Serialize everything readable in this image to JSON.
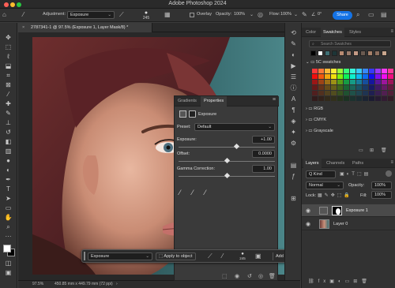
{
  "app_title": "Adobe Photoshop 2024",
  "options_bar": {
    "adjustment_label": "Adjustment:",
    "adjustment_value": "Exposure",
    "brush_size": "245",
    "overlay_label": "Overlay",
    "opacity_label": "Opacity:",
    "opacity_value": "100%",
    "flow_label": "Flow:",
    "flow_value": "100%",
    "angle_value": "0°",
    "share_label": "Share"
  },
  "document": {
    "tab_label": "2787341-1 @ 97.5% (Exposure 1, Layer Mask/8) *",
    "zoom": "97.5%",
    "dimensions": "450.85 mm x 449.79 mm (72 ppi)"
  },
  "properties": {
    "tabs": [
      "Gradients",
      "Properties"
    ],
    "active_tab": "Properties",
    "section_title": "Exposure",
    "preset_label": "Preset:",
    "preset_value": "Default",
    "exposure_label": "Exposure:",
    "exposure_value": "+1.00",
    "exposure_pos": 0.6,
    "offset_label": "Offset:",
    "offset_value": "0.0000",
    "offset_pos": 0.5,
    "gamma_label": "Gamma Correction:",
    "gamma_value": "1.00",
    "gamma_pos": 0.5
  },
  "taskbar": {
    "adjustment_value": "Exposure",
    "apply_label": "Apply to object",
    "brush_size": "245",
    "add_label": "Add new adjustment",
    "more_label": "···"
  },
  "swatches_panel": {
    "tabs": [
      "Color",
      "Swatches",
      "Styles"
    ],
    "active_tab": "Swatches",
    "search_placeholder": "Search Swatches",
    "folders": [
      "5C swatches",
      "RGB",
      "CMYK",
      "Grayscale"
    ]
  },
  "layers_panel": {
    "tabs": [
      "Layers",
      "Channels",
      "Paths"
    ],
    "active_tab": "Layers",
    "kind_label": "Q Kind",
    "blend_mode": "Normal",
    "opacity_label": "Opacity:",
    "opacity_value": "100%",
    "lock_label": "Lock:",
    "fill_label": "Fill:",
    "fill_value": "100%",
    "layers": [
      {
        "name": "Exposure 1"
      },
      {
        "name": "Layer 0"
      }
    ]
  },
  "colors": {
    "accent": "#1473e6",
    "panel_bg": "#323232",
    "canvas_bg": "#282828",
    "teal_bg": "#3a6e72"
  }
}
